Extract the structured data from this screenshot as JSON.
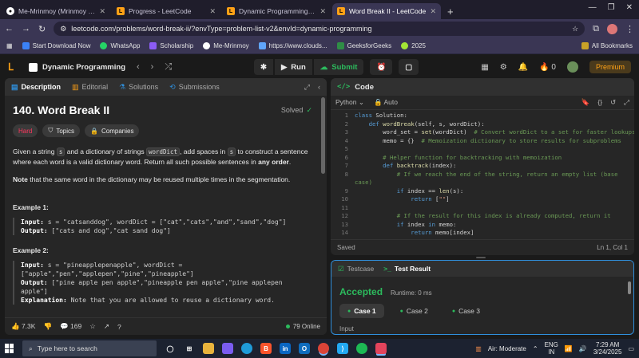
{
  "browser": {
    "tabs": [
      {
        "title": "Me-Mrinmoy (Mrinmoy Saman",
        "icon": "github",
        "active": false
      },
      {
        "title": "Progress - LeetCode",
        "icon": "leetcode",
        "active": false
      },
      {
        "title": "Dynamic Programming - LeetC",
        "icon": "leetcode",
        "active": false
      },
      {
        "title": "Word Break II - LeetCode",
        "icon": "leetcode",
        "active": true
      }
    ],
    "url": "leetcode.com/problems/word-break-ii/?envType=problem-list-v2&envId=dynamic-programming",
    "bookmarks": [
      {
        "label": "Start Download Now",
        "color": "#3b82f6"
      },
      {
        "label": "WhatsApp",
        "color": "#25d366"
      },
      {
        "label": "Scholarship",
        "color": "#8b5cf6"
      },
      {
        "label": "Me-Mrinmoy",
        "color": "#ffffff"
      },
      {
        "label": "https://www.clouds...",
        "color": "#60a5fa"
      },
      {
        "label": "GeeksforGeeks",
        "color": "#2f8d46"
      },
      {
        "label": "2025",
        "color": "#a3e635"
      }
    ],
    "all_bookmarks": "All Bookmarks"
  },
  "lc": {
    "problem_list": "Dynamic Programming",
    "run": "Run",
    "submit": "Submit",
    "coins": "0",
    "premium": "Premium"
  },
  "left": {
    "tabs": [
      "Description",
      "Editorial",
      "Solutions",
      "Submissions"
    ],
    "title": "140. Word Break II",
    "solved": "Solved",
    "chips": [
      "Hard",
      "Topics",
      "Companies"
    ],
    "desc": {
      "p1": "Given a string",
      "s": "s",
      "p2": "and a dictionary of strings",
      "wordDict": "wordDict",
      "p3": ", add spaces in",
      "p4": "to construct a sentence where each word is a valid dictionary word. Return all such possible sentences in",
      "any_order": "any order",
      "dot": "."
    },
    "note_bold": "Note",
    "note_text": "that the same word in the dictionary may be reused multiple times in the segmentation.",
    "examples": [
      {
        "heading": "Example 1:",
        "input_label": "Input:",
        "input": "s = \"catsanddog\", wordDict = [\"cat\",\"cats\",\"and\",\"sand\",\"dog\"]",
        "output_label": "Output:",
        "output": "[\"cats and dog\",\"cat sand dog\"]"
      },
      {
        "heading": "Example 2:",
        "input_label": "Input:",
        "input": "s = \"pineapplepenapple\", wordDict = [\"apple\",\"pen\",\"applepen\",\"pine\",\"pineapple\"]",
        "output_label": "Output:",
        "output": "[\"pine apple pen apple\",\"pineapple pen apple\",\"pine applepen apple\"]",
        "explanation_label": "Explanation:",
        "explanation": "Note that you are allowed to reuse a dictionary word."
      }
    ],
    "footer": {
      "likes": "7.3K",
      "comments": "169",
      "online": "79 Online"
    }
  },
  "code": {
    "header": "Code",
    "language": "Python",
    "mode": "Auto",
    "saved": "Saved",
    "cursor": "Ln 1, Col 1"
  },
  "test": {
    "tabs": [
      "Testcase",
      "Test Result"
    ],
    "status": "Accepted",
    "runtime": "Runtime: 0 ms",
    "cases": [
      "Case 1",
      "Case 2",
      "Case 3"
    ],
    "input_label": "Input"
  },
  "taskbar": {
    "search": "Type here to search",
    "weather": "Air: Moderate",
    "lang1": "ENG",
    "lang2": "IN",
    "time": "7:29 AM",
    "date": "3/24/2025"
  }
}
